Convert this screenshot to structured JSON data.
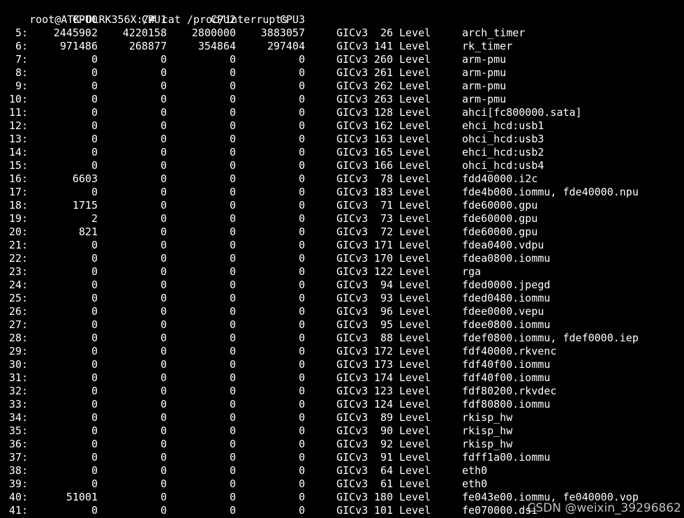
{
  "terminal": {
    "prompt": "root@ATK-DLRK356X:/# cat /proc/interrupts",
    "headers": [
      "CPU0",
      "CPU1",
      "CPU2",
      "CPU3"
    ],
    "rows": [
      {
        "irq": "5:",
        "cpu0": "2445902",
        "cpu1": "4220158",
        "cpu2": "2800000",
        "cpu3": "3883057",
        "controller": "GICv3",
        "hwirq": "26",
        "type": "Level",
        "device": "arch_timer"
      },
      {
        "irq": "6:",
        "cpu0": "971486",
        "cpu1": "268877",
        "cpu2": "354864",
        "cpu3": "297404",
        "controller": "GICv3",
        "hwirq": "141",
        "type": "Level",
        "device": "rk_timer"
      },
      {
        "irq": "7:",
        "cpu0": "0",
        "cpu1": "0",
        "cpu2": "0",
        "cpu3": "0",
        "controller": "GICv3",
        "hwirq": "260",
        "type": "Level",
        "device": "arm-pmu"
      },
      {
        "irq": "8:",
        "cpu0": "0",
        "cpu1": "0",
        "cpu2": "0",
        "cpu3": "0",
        "controller": "GICv3",
        "hwirq": "261",
        "type": "Level",
        "device": "arm-pmu"
      },
      {
        "irq": "9:",
        "cpu0": "0",
        "cpu1": "0",
        "cpu2": "0",
        "cpu3": "0",
        "controller": "GICv3",
        "hwirq": "262",
        "type": "Level",
        "device": "arm-pmu"
      },
      {
        "irq": "10:",
        "cpu0": "0",
        "cpu1": "0",
        "cpu2": "0",
        "cpu3": "0",
        "controller": "GICv3",
        "hwirq": "263",
        "type": "Level",
        "device": "arm-pmu"
      },
      {
        "irq": "11:",
        "cpu0": "0",
        "cpu1": "0",
        "cpu2": "0",
        "cpu3": "0",
        "controller": "GICv3",
        "hwirq": "128",
        "type": "Level",
        "device": "ahci[fc800000.sata]"
      },
      {
        "irq": "12:",
        "cpu0": "0",
        "cpu1": "0",
        "cpu2": "0",
        "cpu3": "0",
        "controller": "GICv3",
        "hwirq": "162",
        "type": "Level",
        "device": "ehci_hcd:usb1"
      },
      {
        "irq": "13:",
        "cpu0": "0",
        "cpu1": "0",
        "cpu2": "0",
        "cpu3": "0",
        "controller": "GICv3",
        "hwirq": "163",
        "type": "Level",
        "device": "ohci_hcd:usb3"
      },
      {
        "irq": "14:",
        "cpu0": "0",
        "cpu1": "0",
        "cpu2": "0",
        "cpu3": "0",
        "controller": "GICv3",
        "hwirq": "165",
        "type": "Level",
        "device": "ehci_hcd:usb2"
      },
      {
        "irq": "15:",
        "cpu0": "0",
        "cpu1": "0",
        "cpu2": "0",
        "cpu3": "0",
        "controller": "GICv3",
        "hwirq": "166",
        "type": "Level",
        "device": "ohci_hcd:usb4"
      },
      {
        "irq": "16:",
        "cpu0": "6603",
        "cpu1": "0",
        "cpu2": "0",
        "cpu3": "0",
        "controller": "GICv3",
        "hwirq": "78",
        "type": "Level",
        "device": "fdd40000.i2c"
      },
      {
        "irq": "17:",
        "cpu0": "0",
        "cpu1": "0",
        "cpu2": "0",
        "cpu3": "0",
        "controller": "GICv3",
        "hwirq": "183",
        "type": "Level",
        "device": "fde4b000.iommu, fde40000.npu"
      },
      {
        "irq": "18:",
        "cpu0": "1715",
        "cpu1": "0",
        "cpu2": "0",
        "cpu3": "0",
        "controller": "GICv3",
        "hwirq": "71",
        "type": "Level",
        "device": "fde60000.gpu"
      },
      {
        "irq": "19:",
        "cpu0": "2",
        "cpu1": "0",
        "cpu2": "0",
        "cpu3": "0",
        "controller": "GICv3",
        "hwirq": "73",
        "type": "Level",
        "device": "fde60000.gpu"
      },
      {
        "irq": "20:",
        "cpu0": "821",
        "cpu1": "0",
        "cpu2": "0",
        "cpu3": "0",
        "controller": "GICv3",
        "hwirq": "72",
        "type": "Level",
        "device": "fde60000.gpu"
      },
      {
        "irq": "21:",
        "cpu0": "0",
        "cpu1": "0",
        "cpu2": "0",
        "cpu3": "0",
        "controller": "GICv3",
        "hwirq": "171",
        "type": "Level",
        "device": "fdea0400.vdpu"
      },
      {
        "irq": "22:",
        "cpu0": "0",
        "cpu1": "0",
        "cpu2": "0",
        "cpu3": "0",
        "controller": "GICv3",
        "hwirq": "170",
        "type": "Level",
        "device": "fdea0800.iommu"
      },
      {
        "irq": "23:",
        "cpu0": "0",
        "cpu1": "0",
        "cpu2": "0",
        "cpu3": "0",
        "controller": "GICv3",
        "hwirq": "122",
        "type": "Level",
        "device": "rga"
      },
      {
        "irq": "24:",
        "cpu0": "0",
        "cpu1": "0",
        "cpu2": "0",
        "cpu3": "0",
        "controller": "GICv3",
        "hwirq": "94",
        "type": "Level",
        "device": "fded0000.jpegd"
      },
      {
        "irq": "25:",
        "cpu0": "0",
        "cpu1": "0",
        "cpu2": "0",
        "cpu3": "0",
        "controller": "GICv3",
        "hwirq": "93",
        "type": "Level",
        "device": "fded0480.iommu"
      },
      {
        "irq": "26:",
        "cpu0": "0",
        "cpu1": "0",
        "cpu2": "0",
        "cpu3": "0",
        "controller": "GICv3",
        "hwirq": "96",
        "type": "Level",
        "device": "fdee0000.vepu"
      },
      {
        "irq": "27:",
        "cpu0": "0",
        "cpu1": "0",
        "cpu2": "0",
        "cpu3": "0",
        "controller": "GICv3",
        "hwirq": "95",
        "type": "Level",
        "device": "fdee0800.iommu"
      },
      {
        "irq": "28:",
        "cpu0": "0",
        "cpu1": "0",
        "cpu2": "0",
        "cpu3": "0",
        "controller": "GICv3",
        "hwirq": "88",
        "type": "Level",
        "device": "fdef0800.iommu, fdef0000.iep"
      },
      {
        "irq": "29:",
        "cpu0": "0",
        "cpu1": "0",
        "cpu2": "0",
        "cpu3": "0",
        "controller": "GICv3",
        "hwirq": "172",
        "type": "Level",
        "device": "fdf40000.rkvenc"
      },
      {
        "irq": "30:",
        "cpu0": "0",
        "cpu1": "0",
        "cpu2": "0",
        "cpu3": "0",
        "controller": "GICv3",
        "hwirq": "173",
        "type": "Level",
        "device": "fdf40f00.iommu"
      },
      {
        "irq": "31:",
        "cpu0": "0",
        "cpu1": "0",
        "cpu2": "0",
        "cpu3": "0",
        "controller": "GICv3",
        "hwirq": "174",
        "type": "Level",
        "device": "fdf40f00.iommu"
      },
      {
        "irq": "32:",
        "cpu0": "0",
        "cpu1": "0",
        "cpu2": "0",
        "cpu3": "0",
        "controller": "GICv3",
        "hwirq": "123",
        "type": "Level",
        "device": "fdf80200.rkvdec"
      },
      {
        "irq": "33:",
        "cpu0": "0",
        "cpu1": "0",
        "cpu2": "0",
        "cpu3": "0",
        "controller": "GICv3",
        "hwirq": "124",
        "type": "Level",
        "device": "fdf80800.iommu"
      },
      {
        "irq": "34:",
        "cpu0": "0",
        "cpu1": "0",
        "cpu2": "0",
        "cpu3": "0",
        "controller": "GICv3",
        "hwirq": "89",
        "type": "Level",
        "device": "rkisp_hw"
      },
      {
        "irq": "35:",
        "cpu0": "0",
        "cpu1": "0",
        "cpu2": "0",
        "cpu3": "0",
        "controller": "GICv3",
        "hwirq": "90",
        "type": "Level",
        "device": "rkisp_hw"
      },
      {
        "irq": "36:",
        "cpu0": "0",
        "cpu1": "0",
        "cpu2": "0",
        "cpu3": "0",
        "controller": "GICv3",
        "hwirq": "92",
        "type": "Level",
        "device": "rkisp_hw"
      },
      {
        "irq": "37:",
        "cpu0": "0",
        "cpu1": "0",
        "cpu2": "0",
        "cpu3": "0",
        "controller": "GICv3",
        "hwirq": "91",
        "type": "Level",
        "device": "fdff1a00.iommu"
      },
      {
        "irq": "38:",
        "cpu0": "0",
        "cpu1": "0",
        "cpu2": "0",
        "cpu3": "0",
        "controller": "GICv3",
        "hwirq": "64",
        "type": "Level",
        "device": "eth0"
      },
      {
        "irq": "39:",
        "cpu0": "0",
        "cpu1": "0",
        "cpu2": "0",
        "cpu3": "0",
        "controller": "GICv3",
        "hwirq": "61",
        "type": "Level",
        "device": "eth0"
      },
      {
        "irq": "40:",
        "cpu0": "51001",
        "cpu1": "0",
        "cpu2": "0",
        "cpu3": "0",
        "controller": "GICv3",
        "hwirq": "180",
        "type": "Level",
        "device": "fe043e00.iommu, fe040000.vop"
      },
      {
        "irq": "41:",
        "cpu0": "0",
        "cpu1": "0",
        "cpu2": "0",
        "cpu3": "0",
        "controller": "GICv3",
        "hwirq": "101",
        "type": "Level",
        "device": "fe070000.dsi"
      }
    ]
  },
  "watermark": "CSDN @weixin_39296862",
  "colors": {
    "background": "#000000",
    "text": "#ffffff"
  }
}
